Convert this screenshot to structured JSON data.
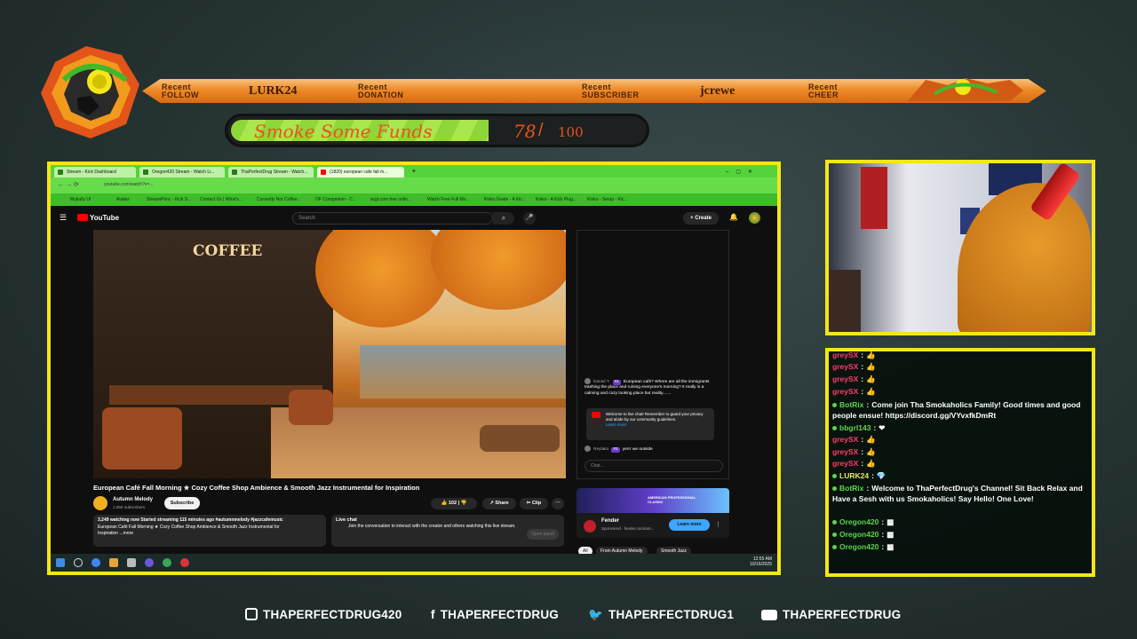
{
  "banner": {
    "items": [
      {
        "label_top": "Recent",
        "label_bottom": "FOLLOW",
        "value": "LURK24"
      },
      {
        "label_top": "Recent",
        "label_bottom": "DONATION",
        "value": ""
      },
      {
        "label_top": "Recent",
        "label_bottom": "SUBSCRIBER",
        "value": "jcrewe"
      },
      {
        "label_top": "Recent",
        "label_bottom": "CHEER",
        "value": ""
      }
    ]
  },
  "goal": {
    "title": "Smoke Some Funds",
    "current": "78",
    "separator": "/",
    "max": "100",
    "progress": 0.78
  },
  "browser": {
    "tabs": [
      "Stream - Kick Dashboard",
      "Oregon420 Stream - Watch Li...",
      "ThaPerfectDrug Stream - Watch...",
      "(1820) european cafe fall m..."
    ],
    "url": "youtube.com/watch?v=...",
    "bookmarks": [
      "Mybully UI",
      "Avatar",
      "StreamPrinc - Kick S...",
      "Contact Us | What's...",
      "Currently Not Coffee...",
      "OF Companion - C...",
      "scgt.com free onlin...",
      "Watch Free Full Mo...",
      "Kinko Guide - A Kic...",
      "Kinko - A Kick Plug...",
      "Kinko - Setup - Kic..."
    ]
  },
  "youtube": {
    "logo": "YouTube",
    "search_placeholder": "Search",
    "create_label": "Create",
    "notif_count": "9+",
    "video_sign": "COFFEE",
    "title": "European Café Fall Morning ★ Cozy Coffee Shop Ambience & Smooth Jazz Instrumental for Inspiration",
    "channel": "Autumn Melody",
    "subs": "1.55K subscribers",
    "subscribe": "Subscribe",
    "likes": "102",
    "share": "Share",
    "clip": "Clip",
    "desc_line1": "3,249 watching now  Started streaming 115 minutes ago  #autumnmelody #jazzcafemusic",
    "desc_line2": "European Café Fall Morning ★ Cozy Coffee Shop Ambience & Smooth  Jazz Instrumental for",
    "desc_line3": "Inspiration  ...more",
    "livechat_title": "Live chat",
    "livechat_text": "Join the conversation to interact with the creator and others watching this live stream.",
    "open_panel": "Open panel",
    "chat": {
      "msg1_user": "Daniel T.",
      "msg1_badge": "#1",
      "msg1_text": "European café? Where are all the immigrants trashing the place and ruining everyone's morning? It really is a calming and cozy looking place but reality.......",
      "welcome": "Welcome to live chat! Remember to guard your privacy and abide by our community guidelines.",
      "learn_more": "Learn more",
      "msg2_user": "Reylako",
      "msg2_badge": "#2",
      "msg2_text": "yerrr we outside",
      "input_placeholder": "Chat..."
    },
    "ad": {
      "name": "Fender",
      "sponsored": "Sponsored · fender.com/am...",
      "button": "Learn more",
      "banner": "AMERICAN PROFESSIONAL CLASSIC"
    },
    "chips": [
      "All",
      "From Autumn Melody",
      "Smooth Jazz"
    ],
    "clock_time": "12:55 AM",
    "clock_date": "10/16/2025"
  },
  "kick_chat": [
    {
      "user": "greySX",
      "sep": ":",
      "text": "👍"
    },
    {
      "user": "greySX",
      "sep": ":",
      "text": "👍"
    },
    {
      "user": "greySX",
      "sep": ":",
      "text": "👍"
    },
    {
      "user": "greySX",
      "sep": ":",
      "text": "👍"
    },
    {
      "user": "BotRix",
      "sep": ":",
      "text": "Come join Tha Smokaholics Family! Good times and good people ensue! https://discord.gg/VYvxfkDmRt"
    },
    {
      "user": "bbgrl143",
      "sep": ":",
      "text": "❤"
    },
    {
      "user": "greySX",
      "sep": ":",
      "text": "👍"
    },
    {
      "user": "greySX",
      "sep": ":",
      "text": "👍"
    },
    {
      "user": "greySX",
      "sep": ":",
      "text": "👍"
    },
    {
      "user": "LURK24",
      "sep": ":",
      "text": "💎"
    },
    {
      "user": "BotRix",
      "sep": ":",
      "text": "Welcome to ThaPerfectDrug's Channel! Sit Back Relax and Have a Sesh with us Smokaholics! Say Hello! One Love!"
    },
    {
      "user": "Oregon420",
      "sep": ":",
      "text": "▩"
    },
    {
      "user": "Oregon420",
      "sep": ":",
      "text": "▩"
    },
    {
      "user": "Oregon420",
      "sep": ":",
      "text": "▩"
    }
  ],
  "socials": [
    {
      "icon": "instagram-icon",
      "label": "THAPERFECTDRUG420"
    },
    {
      "icon": "facebook-icon",
      "label": "THAPERFECTDRUG"
    },
    {
      "icon": "twitter-icon",
      "label": "THAPERFECTDRUG1"
    },
    {
      "icon": "youtube-icon",
      "label": "THAPERFECTDRUG"
    }
  ],
  "colors": {
    "frame": "#f4e61a",
    "goal_fill": "#8fd63a",
    "goal_text": "#e8541c",
    "banner": "#ee8a27"
  }
}
